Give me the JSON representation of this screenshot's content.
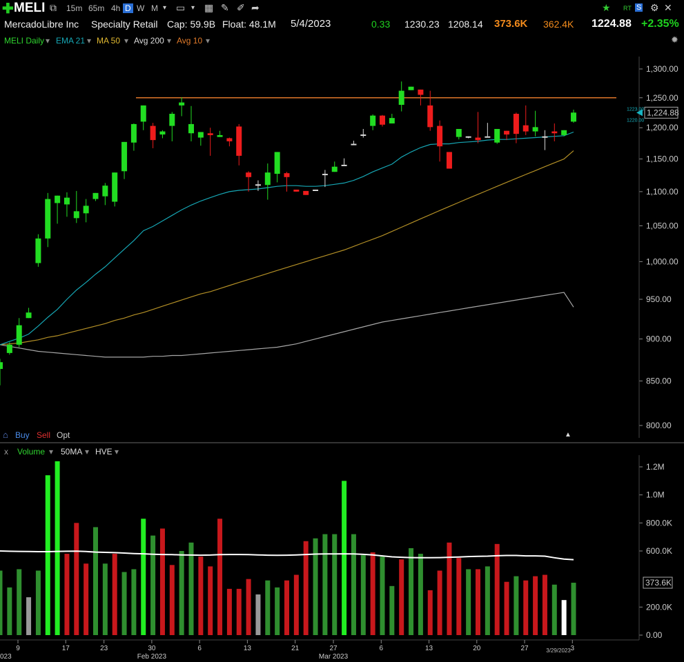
{
  "toolbar": {
    "symbol": "MELI",
    "timeframes": [
      "15m",
      "65m",
      "4h",
      "D",
      "W",
      "M"
    ],
    "selected_timeframe": "D",
    "right_icons": [
      "star-icon",
      "rt-icon",
      "s-icon",
      "gear-icon",
      "close-icon"
    ]
  },
  "info": {
    "name": "MercadoLibre Inc",
    "industry": "Specialty Retail",
    "cap": "Cap: 59.9B",
    "float": "Float: 48.1M",
    "date": "5/4/2023",
    "change": "0.33",
    "high": "1230.23",
    "low": "1208.14",
    "volume": "373.6K",
    "avg_volume": "362.4K",
    "price": "1224.88",
    "pct_change": "+2.35%"
  },
  "legend": {
    "chart": "MELI Daily",
    "ema": "EMA 21",
    "ma": "MA 50",
    "avg200": "Avg 200",
    "avg10": "Avg 10"
  },
  "trade": {
    "buy": "Buy",
    "sell": "Sell",
    "opt": "Opt"
  },
  "volume_legend": {
    "close": "x",
    "volume": "Volume",
    "ma": "50MA",
    "hve": "HVE"
  },
  "colors": {
    "up": "#22dd22",
    "down": "#ee1c1c",
    "neutral": "#d8d8d8",
    "ema21": "#16a7b5",
    "ma50": "#b49026",
    "avg200": "#a8a8a8",
    "resistance": "#e0762a",
    "vol_up": "#2f8f2f",
    "vol_down": "#c8181c"
  },
  "chart_data": {
    "type": "candlestick",
    "price_axis": {
      "labels": [
        "1,300.00",
        "1,250.00",
        "1,200.00",
        "1,150.00",
        "1,100.00",
        "1,050.00",
        "1,000.00",
        "950.00",
        "900.00",
        "850.00",
        "800.00"
      ],
      "values": [
        1300,
        1250,
        1200,
        1150,
        1100,
        1050,
        1000,
        950,
        900,
        850,
        800
      ],
      "scale": "log",
      "range": [
        790,
        1320
      ]
    },
    "price_markers": {
      "last": "1,224.88",
      "high_tag": "1223.00",
      "low_tag": "1220.00"
    },
    "resistance": 1250,
    "date_axis": {
      "labels": [
        "9",
        "17",
        "23",
        "30",
        "6",
        "13",
        "21",
        "27",
        "6",
        "13",
        "20",
        "27",
        "3"
      ],
      "bar_index": [
        0,
        5,
        9,
        14,
        19,
        24,
        29,
        33,
        38,
        43,
        48,
        53,
        58
      ],
      "month_labels": [
        {
          "text": "Feb 2023",
          "bar_index": 14
        },
        {
          "text": "Mar 2023",
          "bar_index": 33
        }
      ],
      "start_label": "023",
      "current_date": "3/29/2023"
    },
    "candles": [
      {
        "o": 864,
        "h": 876,
        "l": 845,
        "c": 872
      },
      {
        "o": 883,
        "h": 896,
        "l": 881,
        "c": 893
      },
      {
        "o": 893,
        "h": 926,
        "l": 890,
        "c": 917
      },
      {
        "o": 926,
        "h": 939,
        "l": 928,
        "c": 933
      },
      {
        "o": 998,
        "h": 1038,
        "l": 993,
        "c": 1032
      },
      {
        "o": 1032,
        "h": 1098,
        "l": 1020,
        "c": 1089
      },
      {
        "o": 1083,
        "h": 1094,
        "l": 1053,
        "c": 1094
      },
      {
        "o": 1081,
        "h": 1099,
        "l": 1063,
        "c": 1091
      },
      {
        "o": 1061,
        "h": 1101,
        "l": 1054,
        "c": 1071
      },
      {
        "o": 1068,
        "h": 1089,
        "l": 1055,
        "c": 1079
      },
      {
        "o": 1089,
        "h": 1098,
        "l": 1086,
        "c": 1098
      },
      {
        "o": 1093,
        "h": 1113,
        "l": 1080,
        "c": 1109
      },
      {
        "o": 1085,
        "h": 1119,
        "l": 1078,
        "c": 1129
      },
      {
        "o": 1131,
        "h": 1170,
        "l": 1119,
        "c": 1177
      },
      {
        "o": 1176,
        "h": 1207,
        "l": 1163,
        "c": 1206
      },
      {
        "o": 1210,
        "h": 1226,
        "l": 1196,
        "c": 1237
      },
      {
        "o": 1203,
        "h": 1208,
        "l": 1167,
        "c": 1180
      },
      {
        "o": 1189,
        "h": 1196,
        "l": 1183,
        "c": 1194
      },
      {
        "o": 1203,
        "h": 1226,
        "l": 1178,
        "c": 1223
      },
      {
        "o": 1237,
        "h": 1251,
        "l": 1219,
        "c": 1242
      },
      {
        "o": 1191,
        "h": 1236,
        "l": 1178,
        "c": 1206
      },
      {
        "o": 1184,
        "h": 1190,
        "l": 1171,
        "c": 1193
      },
      {
        "o": 1191,
        "h": 1200,
        "l": 1155,
        "c": 1188
      },
      {
        "o": 1185,
        "h": 1195,
        "l": 1185,
        "c": 1188
      },
      {
        "o": 1183,
        "h": 1184,
        "l": 1170,
        "c": 1178
      },
      {
        "o": 1202,
        "h": 1206,
        "l": 1140,
        "c": 1155
      },
      {
        "o": 1129,
        "h": 1131,
        "l": 1100,
        "c": 1122
      },
      {
        "o": 1111,
        "h": 1117,
        "l": 1101,
        "c": 1110
      },
      {
        "o": 1110,
        "h": 1143,
        "l": 1088,
        "c": 1129
      },
      {
        "o": 1127,
        "h": 1155,
        "l": 1114,
        "c": 1161
      },
      {
        "o": 1128,
        "h": 1130,
        "l": 1100,
        "c": 1122
      },
      {
        "o": 1103,
        "h": 1103,
        "l": 1106,
        "c": 1100
      },
      {
        "o": 1101,
        "h": 1099,
        "l": 1113,
        "c": 1095
      },
      {
        "o": 1102,
        "h": 1094,
        "l": 1120,
        "c": 1103
      },
      {
        "o": 1127,
        "h": 1133,
        "l": 1107,
        "c": 1126
      },
      {
        "o": 1130,
        "h": 1146,
        "l": 1134,
        "c": 1138
      },
      {
        "o": 1141,
        "h": 1151,
        "l": 1142,
        "c": 1141
      },
      {
        "o": 1174,
        "h": 1179,
        "l": 1172,
        "c": 1173
      },
      {
        "o": 1187,
        "h": 1198,
        "l": 1184,
        "c": 1189
      },
      {
        "o": 1203,
        "h": 1222,
        "l": 1196,
        "c": 1220
      },
      {
        "o": 1220,
        "h": 1221,
        "l": 1202,
        "c": 1205
      },
      {
        "o": 1207,
        "h": 1223,
        "l": 1211,
        "c": 1216
      },
      {
        "o": 1238,
        "h": 1278,
        "l": 1227,
        "c": 1262
      },
      {
        "o": 1263,
        "h": 1255,
        "l": 1270,
        "c": 1269
      },
      {
        "o": 1264,
        "h": 1233,
        "l": 1237,
        "c": 1255
      },
      {
        "o": 1237,
        "h": 1262,
        "l": 1195,
        "c": 1201
      },
      {
        "o": 1203,
        "h": 1212,
        "l": 1146,
        "c": 1170
      },
      {
        "o": 1161,
        "h": 1153,
        "l": 1140,
        "c": 1135
      },
      {
        "o": 1185,
        "h": 1183,
        "l": 1181,
        "c": 1198
      },
      {
        "o": 1185,
        "h": 1181,
        "l": 1183,
        "c": 1186
      },
      {
        "o": 1184,
        "h": 1226,
        "l": 1175,
        "c": 1180
      },
      {
        "o": 1186,
        "h": 1208,
        "l": 1191,
        "c": 1186
      },
      {
        "o": 1176,
        "h": 1197,
        "l": 1174,
        "c": 1198
      },
      {
        "o": 1195,
        "h": 1192,
        "l": 1180,
        "c": 1189
      },
      {
        "o": 1223,
        "h": 1225,
        "l": 1175,
        "c": 1190
      },
      {
        "o": 1204,
        "h": 1237,
        "l": 1188,
        "c": 1194
      },
      {
        "o": 1194,
        "h": 1228,
        "l": 1186,
        "c": 1201
      },
      {
        "o": 1184,
        "h": 1196,
        "l": 1164,
        "c": 1186
      },
      {
        "o": 1194,
        "h": 1207,
        "l": 1178,
        "c": 1191
      },
      {
        "o": 1188,
        "h": 1194,
        "l": 1186,
        "c": 1196
      },
      {
        "o": 1210,
        "h": 1230,
        "l": 1208,
        "c": 1225
      }
    ],
    "ema21": [
      893,
      897,
      901,
      906,
      916,
      927,
      937,
      950,
      962,
      972,
      983,
      993,
      1005,
      1017,
      1029,
      1043,
      1049,
      1057,
      1065,
      1073,
      1080,
      1086,
      1091,
      1096,
      1100,
      1102,
      1103,
      1104,
      1106,
      1108,
      1109,
      1109,
      1108,
      1108,
      1109,
      1111,
      1113,
      1117,
      1123,
      1130,
      1136,
      1142,
      1153,
      1161,
      1168,
      1173,
      1174,
      1174,
      1176,
      1177,
      1178,
      1180,
      1181,
      1181,
      1182,
      1183,
      1184,
      1185,
      1186,
      1187,
      1193
    ],
    "ma50": [
      893,
      894,
      895,
      897,
      899,
      902,
      904,
      907,
      910,
      913,
      916,
      919,
      923,
      926,
      930,
      933,
      937,
      941,
      945,
      949,
      953,
      957,
      960,
      964,
      968,
      972,
      976,
      980,
      984,
      988,
      992,
      996,
      1000,
      1004,
      1008,
      1012,
      1016,
      1021,
      1026,
      1031,
      1036,
      1042,
      1048,
      1054,
      1060,
      1066,
      1072,
      1078,
      1084,
      1090,
      1096,
      1102,
      1108,
      1114,
      1120,
      1126,
      1132,
      1138,
      1144,
      1150,
      1163
    ],
    "avg200": [
      893,
      891,
      889,
      887,
      885,
      884,
      883,
      882,
      881,
      880,
      879,
      878,
      878,
      878,
      878,
      878,
      879,
      879,
      880,
      880,
      881,
      882,
      883,
      884,
      885,
      886,
      887,
      888,
      889,
      890,
      892,
      894,
      897,
      900,
      903,
      906,
      909,
      912,
      915,
      918,
      921,
      923,
      925,
      927,
      929,
      931,
      933,
      935,
      937,
      939,
      941,
      943,
      945,
      947,
      949,
      951,
      953,
      955,
      957,
      959,
      940
    ],
    "volume_axis": {
      "labels": [
        "1.2M",
        "1.0M",
        "800.0K",
        "600.0K",
        "200.0K",
        "0.00"
      ],
      "values": [
        1200000,
        1000000,
        800000,
        600000,
        200000,
        0
      ],
      "max": 1250000
    },
    "volume_marker": "373.6K",
    "volume": [
      {
        "v": 460000,
        "d": "up"
      },
      {
        "v": 340000,
        "d": "up"
      },
      {
        "v": 470000,
        "d": "up"
      },
      {
        "v": 270000,
        "d": "flat"
      },
      {
        "v": 460000,
        "d": "up"
      },
      {
        "v": 1140000,
        "d": "up"
      },
      {
        "v": 1240000,
        "d": "up"
      },
      {
        "v": 580000,
        "d": "down"
      },
      {
        "v": 800000,
        "d": "down"
      },
      {
        "v": 510000,
        "d": "down"
      },
      {
        "v": 770000,
        "d": "up"
      },
      {
        "v": 510000,
        "d": "up"
      },
      {
        "v": 580000,
        "d": "down"
      },
      {
        "v": 450000,
        "d": "up"
      },
      {
        "v": 470000,
        "d": "up"
      },
      {
        "v": 830000,
        "d": "up"
      },
      {
        "v": 710000,
        "d": "up"
      },
      {
        "v": 760000,
        "d": "down"
      },
      {
        "v": 500000,
        "d": "down"
      },
      {
        "v": 600000,
        "d": "up"
      },
      {
        "v": 660000,
        "d": "up"
      },
      {
        "v": 560000,
        "d": "down"
      },
      {
        "v": 490000,
        "d": "down"
      },
      {
        "v": 830000,
        "d": "down"
      },
      {
        "v": 330000,
        "d": "down"
      },
      {
        "v": 330000,
        "d": "down"
      },
      {
        "v": 400000,
        "d": "down"
      },
      {
        "v": 290000,
        "d": "flat"
      },
      {
        "v": 390000,
        "d": "up"
      },
      {
        "v": 340000,
        "d": "up"
      },
      {
        "v": 390000,
        "d": "down"
      },
      {
        "v": 430000,
        "d": "down"
      },
      {
        "v": 670000,
        "d": "down"
      },
      {
        "v": 690000,
        "d": "up"
      },
      {
        "v": 720000,
        "d": "up"
      },
      {
        "v": 720000,
        "d": "up"
      },
      {
        "v": 1100000,
        "d": "up"
      },
      {
        "v": 720000,
        "d": "up"
      },
      {
        "v": 570000,
        "d": "up"
      },
      {
        "v": 590000,
        "d": "down"
      },
      {
        "v": 560000,
        "d": "up"
      },
      {
        "v": 350000,
        "d": "up"
      },
      {
        "v": 540000,
        "d": "down"
      },
      {
        "v": 620000,
        "d": "up"
      },
      {
        "v": 580000,
        "d": "up"
      },
      {
        "v": 320000,
        "d": "down"
      },
      {
        "v": 460000,
        "d": "down"
      },
      {
        "v": 660000,
        "d": "down"
      },
      {
        "v": 550000,
        "d": "down"
      },
      {
        "v": 470000,
        "d": "up"
      },
      {
        "v": 470000,
        "d": "down"
      },
      {
        "v": 490000,
        "d": "up"
      },
      {
        "v": 650000,
        "d": "down"
      },
      {
        "v": 380000,
        "d": "down"
      },
      {
        "v": 420000,
        "d": "up"
      },
      {
        "v": 390000,
        "d": "down"
      },
      {
        "v": 420000,
        "d": "down"
      },
      {
        "v": 430000,
        "d": "down"
      },
      {
        "v": 360000,
        "d": "up"
      },
      {
        "v": 250000,
        "d": "flat"
      },
      {
        "v": 373600,
        "d": "up"
      }
    ],
    "volume_ma50": [
      600000,
      598000,
      597000,
      596000,
      595000,
      595000,
      597000,
      598000,
      599000,
      596000,
      592000,
      590000,
      588000,
      585000,
      582000,
      580000,
      577000,
      575000,
      574000,
      572000,
      571000,
      570000,
      571000,
      574000,
      575000,
      575000,
      574000,
      572000,
      570000,
      569000,
      570000,
      572000,
      575000,
      578000,
      579000,
      579000,
      580000,
      579000,
      576000,
      572000,
      565000,
      558000,
      555000,
      553000,
      552000,
      552000,
      553000,
      555000,
      557000,
      560000,
      562000,
      563000,
      566000,
      568000,
      568000,
      565000,
      565000,
      563000,
      552000,
      542000,
      538000
    ]
  }
}
